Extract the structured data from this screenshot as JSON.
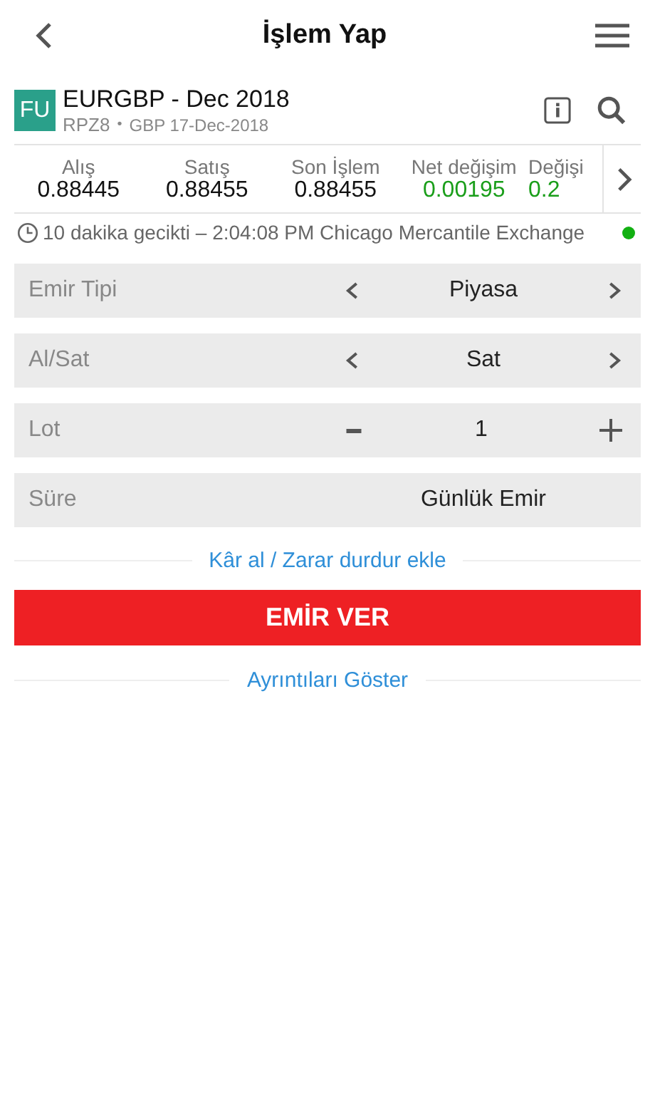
{
  "header": {
    "title": "İşlem Yap"
  },
  "instrument": {
    "badge": "FU",
    "name": "EURGBP - Dec 2018",
    "code": "RPZ8",
    "separator": "•",
    "details": "GBP 17-Dec-2018"
  },
  "quotes": [
    {
      "label": "Alış",
      "value": "0.88445",
      "color": "#111111"
    },
    {
      "label": "Satış",
      "value": "0.88455",
      "color": "#111111"
    },
    {
      "label": "Son İşlem",
      "value": "0.88455",
      "color": "#111111"
    },
    {
      "label": "Net değişim",
      "value": "0.00195",
      "color": "#1a9e1a"
    },
    {
      "label": "Değişi",
      "value": "0.2",
      "color": "#1a9e1a"
    }
  ],
  "delay": {
    "text": "10 dakika gecikti – 2:04:08 PM Chicago Mercantile Exchange"
  },
  "fields": [
    {
      "kind": "stepper",
      "label": "Emir Tipi",
      "value": "Piyasa"
    },
    {
      "kind": "stepper",
      "label": "Al/Sat",
      "value": "Sat"
    },
    {
      "kind": "counter",
      "label": "Lot",
      "value": "1"
    },
    {
      "kind": "plain",
      "label": "Süre",
      "value": "Günlük Emir"
    }
  ],
  "take_profit_link": "Kâr al / Zarar durdur ekle",
  "submit_button": "EMİR VER",
  "details_link": "Ayrıntıları Göster"
}
